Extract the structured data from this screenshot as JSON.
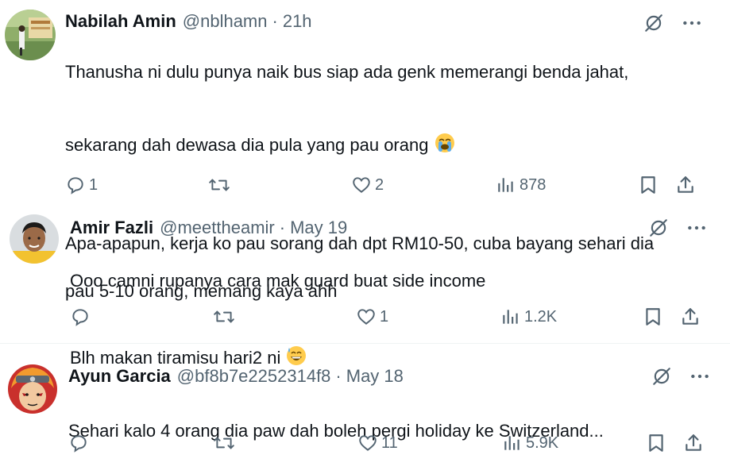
{
  "tweets": [
    {
      "name": "Nabilah Amin",
      "handle": "@nblhamn",
      "separator": "·",
      "time": "21h",
      "line1": "Thanusha ni dulu punya naik bus siap ada genk memerangi benda jahat,",
      "line2": "sekarang dah dewasa dia pula yang pau orang",
      "line3": "Apa-apapun, kerja ko pau sorang dah dpt RM10-50, cuba bayang sehari dia",
      "line4": "pau 5-10 orang, memang kaya ahh",
      "emoji": "loudly-crying-face",
      "replies": "1",
      "retweets": "",
      "likes": "2",
      "views": "878"
    },
    {
      "name": "Amir Fazli",
      "handle": "@meettheamir",
      "separator": "·",
      "time": "May 19",
      "line1": "Ooo camni rupanya cara mak guard buat side income",
      "line2": "Blh makan tiramisu hari2 ni",
      "emoji": "grinning-face-with-sweat",
      "replies": "",
      "retweets": "",
      "likes": "1",
      "views": "1.2K"
    },
    {
      "name": "Ayun Garcia",
      "handle": "@bf8b7e2252314f8",
      "separator": "·",
      "time": "May 18",
      "line1": "Sehari kalo 4 orang dia paw dah boleh pergi holiday ke Switzerland...",
      "replies": "",
      "retweets": "",
      "likes": "11",
      "views": "5.9K"
    }
  ],
  "icons": {
    "top": [
      "grok-icon",
      "more-icon"
    ],
    "actions": [
      "reply-icon",
      "retweet-icon",
      "like-icon",
      "views-icon",
      "bookmark-icon",
      "share-icon"
    ]
  },
  "colors": {
    "text": "#0f1419",
    "secondary": "#536471",
    "divider": "#eff3f4"
  }
}
